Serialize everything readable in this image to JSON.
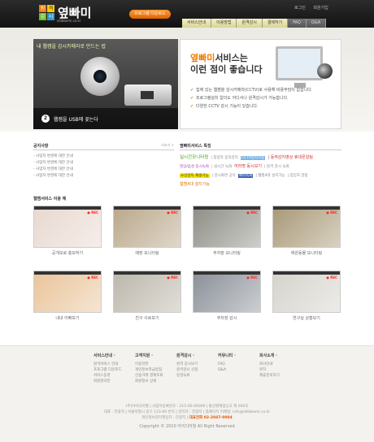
{
  "header": {
    "logo_glyphs": [
      "원",
      "격",
      "감",
      "시"
    ],
    "logo_text": "옆빠미",
    "logo_url": "ollibbemi.co.kr",
    "download_button": "프로그램 다운로드",
    "util_links": [
      "로그인",
      "회원가입"
    ],
    "nav": [
      "서비스안내",
      "이용방법",
      "원격감시",
      "결제하기",
      "FAQ",
      "Q&A"
    ]
  },
  "visual_left": {
    "title": "내 웹캠을 감시카메라로 만드는 법",
    "step_number": "2",
    "step_text": "웹캠을 USB에 꽂는다"
  },
  "visual_right": {
    "headline_accent": "옆빠미",
    "headline_rest": "서비스는",
    "headline_line2": "이런 점이 좋습니다",
    "bullets": [
      "집에 있는 웹캠을 감시카메라(CCTV)로 사용해 비용부담이 없습니다.",
      "프로그램설치 없이도 어디서나 원격감시가 가능합니다.",
      "다양한 CCTV 감시 기능이 있습니다."
    ]
  },
  "notice": {
    "title": "공지사항",
    "more": "더보기 +",
    "items": [
      "- 사업자 변경에 대한 안내",
      "- 사업자 변경에 대한 안내",
      "- 사업자 변경에 대한 안내",
      "- 사업자 변경에 대한 안내"
    ]
  },
  "features": {
    "title": "옆빠미서비스 특징",
    "tags": [
      {
        "text": "실시간모니터링",
        "cls": "g"
      },
      {
        "text": "| 침입자 동작감지",
        "cls": ""
      },
      {
        "text": "CCTV감시기능",
        "cls": "hl"
      },
      {
        "text": "| 동작감지영상 휴대폰알림",
        "cls": "r"
      },
      {
        "text": "영상/음성 동시녹화",
        "cls": "p"
      },
      {
        "text": "| 실시간 녹화",
        "cls": ""
      },
      {
        "text": "여러명 동시보기",
        "cls": "r"
      },
      {
        "text": "| 원격 감시 녹화",
        "cls": ""
      },
      {
        "text": "모션감지 재생기능",
        "cls": "hy"
      },
      {
        "text": "| 감시화면 공유",
        "cls": ""
      },
      {
        "text": "예약녹화",
        "cls": "hb"
      },
      {
        "text": "| 웹캠4대 설치가능",
        "cls": ""
      },
      {
        "text": "| 침입자 알림",
        "cls": ""
      },
      {
        "text": "웹캠4대 설치가능",
        "cls": "o"
      }
    ]
  },
  "examples": {
    "title": "웹캠서비스 이용 예",
    "rec_label": "● REC",
    "items": [
      {
        "caption": "공개모로 홍보하기",
        "color": "#e8d8d0"
      },
      {
        "caption": "매장 모니터링",
        "color": "#b9a78a"
      },
      {
        "caption": "주차장 모니터링",
        "color": "#8e8e86"
      },
      {
        "caption": "애완동물 모니터링",
        "color": "#a89876"
      },
      {
        "caption": "내내 아빠보기",
        "color": "#e9c49a"
      },
      {
        "caption": "친구 사로보기",
        "color": "#bcb6aa"
      },
      {
        "caption": "주차장 감시",
        "color": "#8a9098"
      },
      {
        "caption": "연구실 상황보기",
        "color": "#d6d3cc"
      }
    ]
  },
  "footer": {
    "columns": [
      {
        "title": "서비스안내 ·",
        "items": [
          "원격서비스 안내",
          "프로그램 다운로드",
          "서비스동영",
          "회원정약관"
        ]
      },
      {
        "title": "고객지원 ·",
        "items": [
          "이용약관",
          "개인정보취급방침",
          "신용거래 결제조회",
          "회원정보 상세"
        ]
      },
      {
        "title": "원격감시 ·",
        "items": [
          "원격 감시보기",
          "원격감시 신청",
          "동영녹화"
        ]
      },
      {
        "title": "커뮤니티 ·",
        "items": [
          "FAQ",
          "Q&A"
        ]
      },
      {
        "title": "회사소개 ·",
        "items": [
          "회사안내",
          "위치",
          "제휴문의하기"
        ]
      }
    ],
    "info_line1": "(주)아이디어월 | 사업자등록번호 : 215-00-00000 | 통신판매업신고 제 000호",
    "info_line2": "대표 : 전광지 | 서울특별시 중구 123-00 번지 | 관리자 : 전광지 | 홈페이지 이메일: info@ollibbemi.co.kr",
    "info_line3_prefix": "개인정보관리책임자 : 전광지 |",
    "tel": "대표전화 02-2047-0004",
    "copyright": "Copyright © 2010 아이디어월 All Right Reserved"
  }
}
